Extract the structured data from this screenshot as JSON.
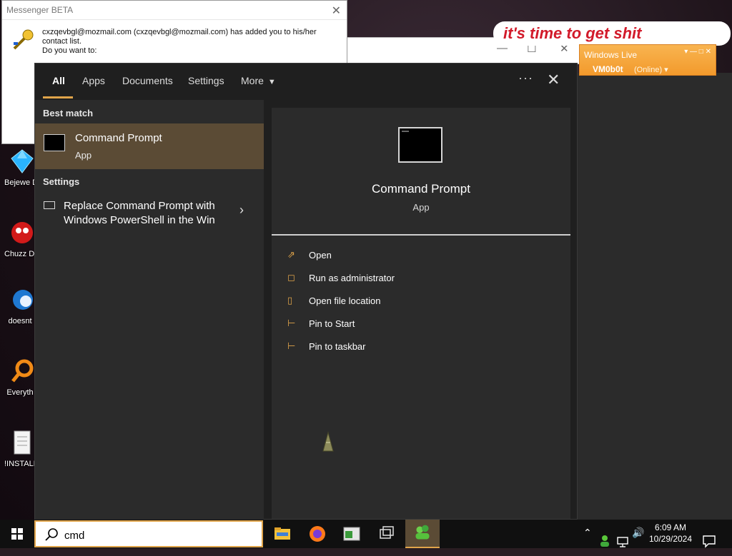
{
  "desktop": {
    "icons": [
      {
        "label": "Bejewe Delux",
        "icon": "gem-icon"
      },
      {
        "label": "Chuzz Delux",
        "icon": "chuzzle-icon"
      },
      {
        "label": "doesnt",
        "icon": "blue-bird-icon"
      },
      {
        "label": "Everyth",
        "icon": "magnifier-icon"
      },
      {
        "label": "!INSTALL",
        "icon": "text-file-icon"
      }
    ]
  },
  "messenger_alert": {
    "title": "Messenger BETA",
    "line1": "cxzqevbgl@mozmail.com (cxzqevbgl@mozmail.com) has added you to his/her contact list.",
    "line2": "Do you want to:"
  },
  "windows_live": {
    "banner": "it's time to get shit",
    "title": "Windows Live",
    "user": "VM0b0t",
    "status": "(Online) ▾"
  },
  "search_panel": {
    "tabs": [
      "All",
      "Apps",
      "Documents",
      "Settings",
      "More"
    ],
    "best_match_label": "Best match",
    "best_match": {
      "title": "Command Prompt",
      "subtitle": "App"
    },
    "settings_label": "Settings",
    "setting_item": "Replace Command Prompt with Windows PowerShell in the Win",
    "preview": {
      "title": "Command Prompt",
      "subtitle": "App"
    },
    "actions": [
      {
        "label": "Open",
        "icon": "open-icon"
      },
      {
        "label": "Run as administrator",
        "icon": "shield-icon"
      },
      {
        "label": "Open file location",
        "icon": "file-location-icon"
      },
      {
        "label": "Pin to Start",
        "icon": "pin-icon"
      },
      {
        "label": "Pin to taskbar",
        "icon": "pin-icon"
      }
    ]
  },
  "taskbar": {
    "search_value": "cmd",
    "apps": [
      "file-explorer-icon",
      "firefox-icon",
      "window-app-icon",
      "task-view-icon",
      "messenger-icon"
    ],
    "time": "6:09 AM",
    "date": "10/29/2024"
  },
  "colors": {
    "accent": "#e0a44a",
    "selected_bg": "#5b4b35",
    "panel_bg": "#2b2b2b"
  }
}
